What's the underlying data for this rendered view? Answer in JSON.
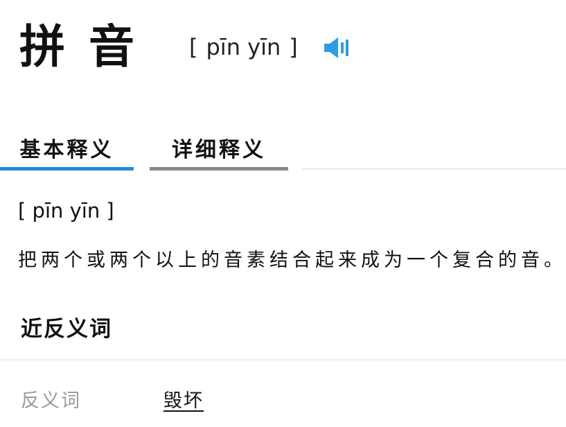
{
  "header": {
    "word": "拼音",
    "pinyin_open": "[",
    "pinyin": "pīn yīn",
    "pinyin_close": "]",
    "speaker_icon": "speaker-icon"
  },
  "tabs": [
    {
      "label": "基本释义",
      "active": true
    },
    {
      "label": "详细释义",
      "active": false
    }
  ],
  "definition": {
    "pinyin": "[ pīn yīn ]",
    "text": "把两个或两个以上的音素结合起来成为一个复合的音。"
  },
  "related": {
    "title": "近反义词",
    "antonym_label": "反义词",
    "antonym_word": "毁坏"
  },
  "colors": {
    "accent": "#1a8ee0",
    "inactive_tab": "#8a8a82",
    "track": "#eeeeee",
    "speaker": "#2b9de3"
  }
}
